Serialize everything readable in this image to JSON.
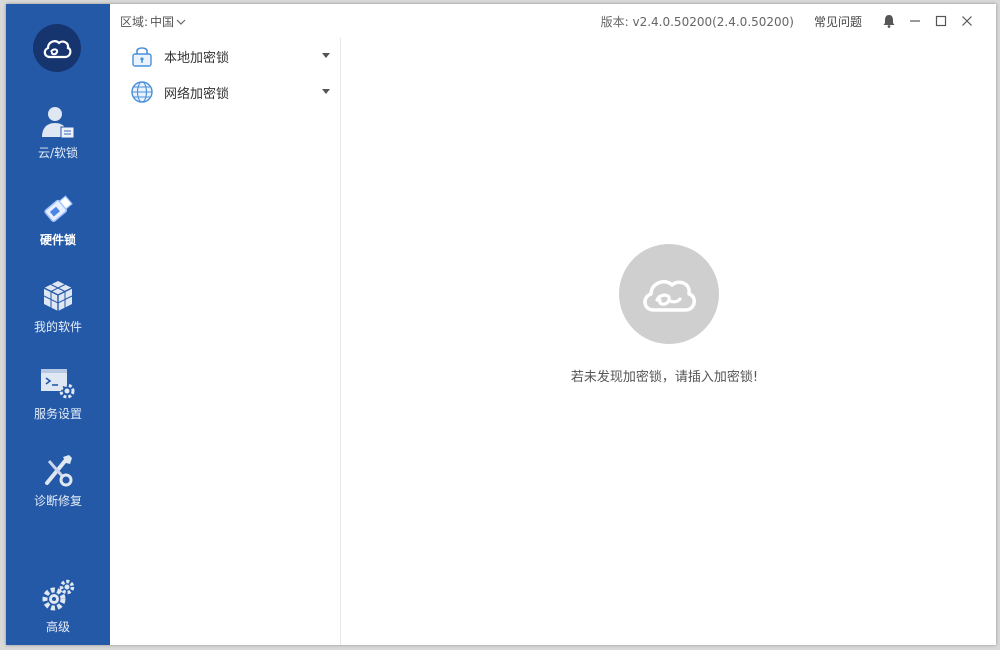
{
  "sidebar": {
    "logo_icon": "cloud-logo-icon",
    "items": [
      {
        "label": "云/软锁",
        "icon": "user-card-icon",
        "active": false
      },
      {
        "label": "硬件锁",
        "icon": "usb-key-icon",
        "active": true
      },
      {
        "label": "我的软件",
        "icon": "cubes-icon",
        "active": false
      },
      {
        "label": "服务设置",
        "icon": "terminal-gear-icon",
        "active": false
      },
      {
        "label": "诊断修复",
        "icon": "wrench-screwdriver-icon",
        "active": false
      },
      {
        "label": "高级",
        "icon": "gears-icon",
        "active": false
      }
    ]
  },
  "topbar": {
    "region_label": "区域:",
    "region_value": "中国",
    "version": "版本: v2.4.0.50200(2.4.0.50200)",
    "faq": "常见问题"
  },
  "tree": {
    "items": [
      {
        "label": "本地加密锁",
        "icon": "padlock-icon"
      },
      {
        "label": "网络加密锁",
        "icon": "globe-icon"
      }
    ]
  },
  "main": {
    "empty_message": "若未发现加密锁，请插入加密锁!"
  },
  "colors": {
    "sidebar": "#2459a8",
    "logo_bg": "#16356f",
    "empty_icon_bg": "#cfcfcf"
  }
}
